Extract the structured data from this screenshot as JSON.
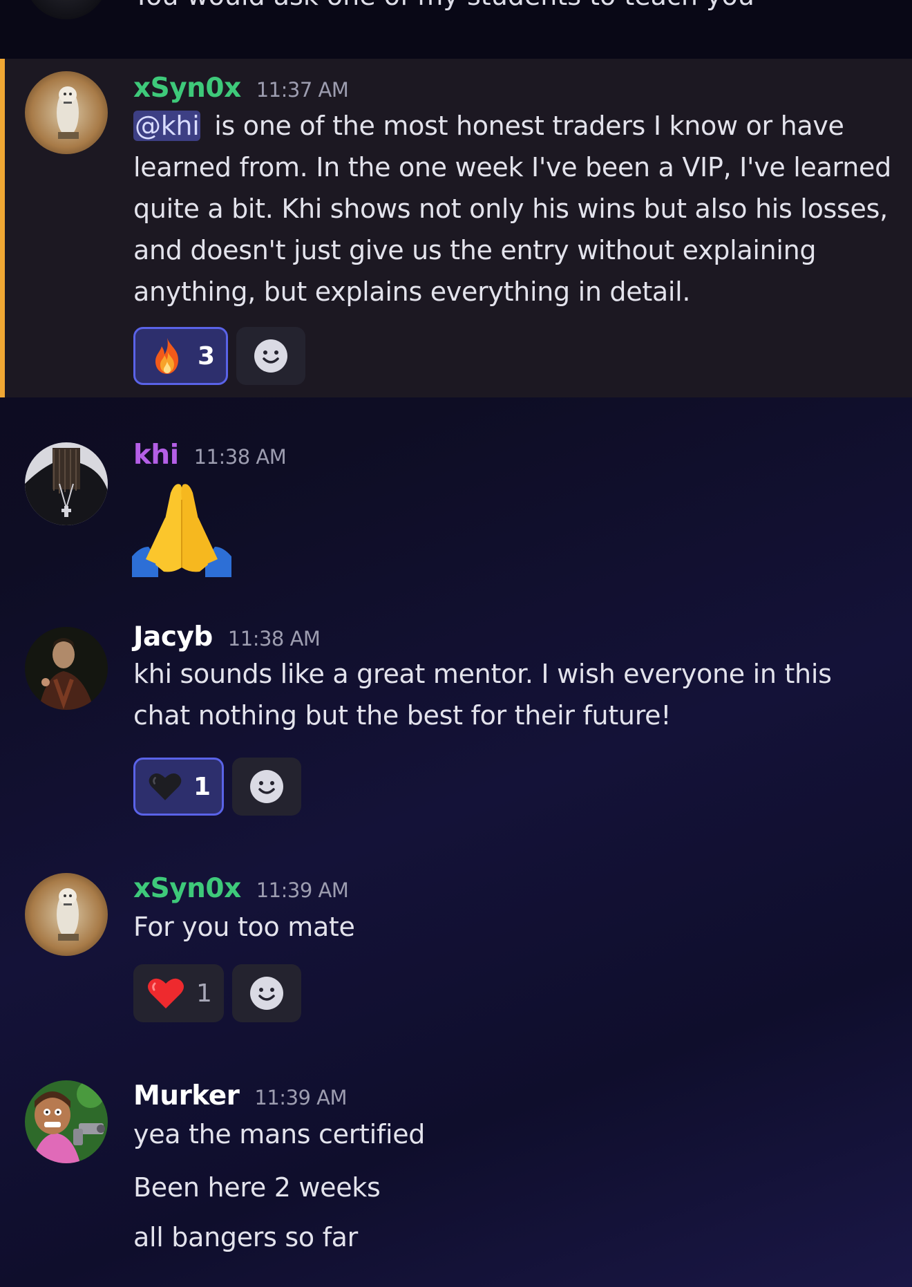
{
  "previous_message": {
    "text": "You would ask one of my students to teach you"
  },
  "messages": [
    {
      "username": "xSyn0x",
      "username_color": "#3ec97a",
      "timestamp": "11:37 AM",
      "highlighted": true,
      "mention": "@khi",
      "text": " is one of the most honest traders I know or have learned from. In the one week I've been a VIP, I've learned quite a bit. Khi shows not only his wins but also his losses, and doesn't just give us the entry without explaining anything, but explains everything in detail.",
      "reactions": [
        {
          "emoji": "fire-emoji",
          "count": "3",
          "active": true
        }
      ]
    },
    {
      "username": "khi",
      "username_color": "#b45fe6",
      "timestamp": "11:38 AM",
      "emoji_message": "folded-hands-emoji"
    },
    {
      "username": "Jacyb",
      "username_color": "#ffffff",
      "timestamp": "11:38 AM",
      "text": "khi sounds like a great mentor. I wish everyone in this chat nothing but the best for their future!",
      "reactions": [
        {
          "emoji": "black-heart-emoji",
          "count": "1",
          "active": true
        }
      ]
    },
    {
      "username": "xSyn0x",
      "username_color": "#3ec97a",
      "timestamp": "11:39 AM",
      "text": "For you too mate",
      "reactions": [
        {
          "emoji": "red-heart-emoji",
          "count": "1",
          "active": false
        }
      ]
    },
    {
      "username": "Murker",
      "username_color": "#ffffff",
      "timestamp": "11:39 AM",
      "lines": [
        "yea the mans certified",
        "Been here 2 weeks",
        "all bangers so far"
      ]
    }
  ],
  "colors": {
    "highlight_bar": "#f0a734",
    "mention_bg": "#3d3f84",
    "reaction_active_border": "#5a63e8"
  }
}
